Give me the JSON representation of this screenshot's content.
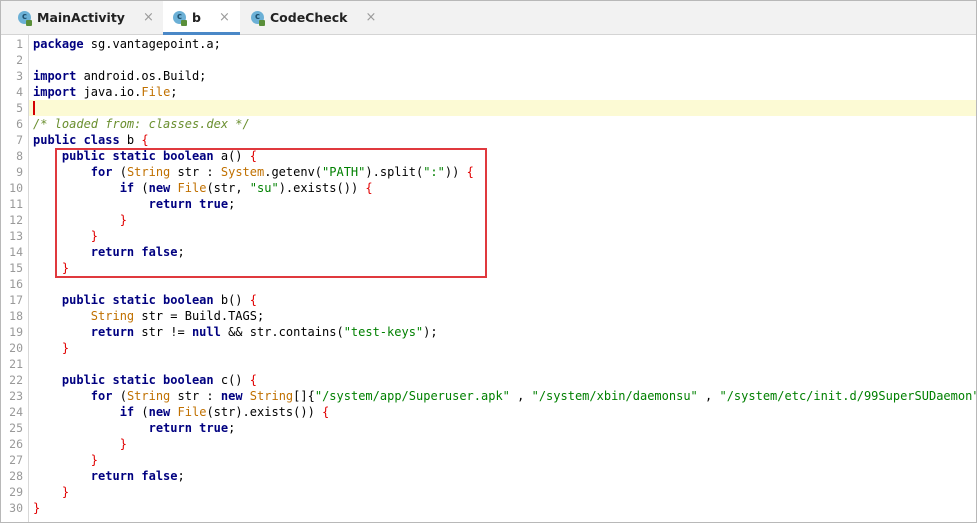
{
  "tabs": [
    {
      "label": "MainActivity",
      "icon": "class-icon",
      "active": false
    },
    {
      "label": "b",
      "icon": "class-icon",
      "active": true
    },
    {
      "label": "CodeCheck",
      "icon": "class-icon",
      "active": false
    }
  ],
  "tab_close_glyph": "×",
  "class_icon_letter": "c",
  "editor": {
    "current_line": 5,
    "highlight_color": "#fcfad4",
    "lines": [
      [
        {
          "t": "package",
          "c": "kw"
        },
        {
          "t": " sg.vantagepoint.a;",
          "c": ""
        }
      ],
      [],
      [
        {
          "t": "import",
          "c": "kw"
        },
        {
          "t": " android.os.Build;",
          "c": ""
        }
      ],
      [
        {
          "t": "import",
          "c": "kw"
        },
        {
          "t": " java.io.",
          "c": ""
        },
        {
          "t": "File",
          "c": "cls"
        },
        {
          "t": ";",
          "c": ""
        }
      ],
      [],
      [
        {
          "t": "/* loaded from: classes.dex */",
          "c": "cmt"
        }
      ],
      [
        {
          "t": "public class",
          "c": "kw"
        },
        {
          "t": " b ",
          "c": ""
        },
        {
          "t": "{",
          "c": "brace"
        }
      ],
      [
        {
          "t": "    ",
          "c": ""
        },
        {
          "t": "public static boolean",
          "c": "kw"
        },
        {
          "t": " a() ",
          "c": ""
        },
        {
          "t": "{",
          "c": "brace"
        }
      ],
      [
        {
          "t": "        ",
          "c": ""
        },
        {
          "t": "for",
          "c": "kw"
        },
        {
          "t": " (",
          "c": ""
        },
        {
          "t": "String",
          "c": "cls"
        },
        {
          "t": " str : ",
          "c": ""
        },
        {
          "t": "System",
          "c": "cls"
        },
        {
          "t": ".getenv(",
          "c": ""
        },
        {
          "t": "\"PATH\"",
          "c": "str"
        },
        {
          "t": ").split(",
          "c": ""
        },
        {
          "t": "\":\"",
          "c": "str"
        },
        {
          "t": ")) ",
          "c": ""
        },
        {
          "t": "{",
          "c": "brace"
        }
      ],
      [
        {
          "t": "            ",
          "c": ""
        },
        {
          "t": "if",
          "c": "kw"
        },
        {
          "t": " (",
          "c": ""
        },
        {
          "t": "new",
          "c": "kw"
        },
        {
          "t": " ",
          "c": ""
        },
        {
          "t": "File",
          "c": "cls"
        },
        {
          "t": "(str, ",
          "c": ""
        },
        {
          "t": "\"su\"",
          "c": "str"
        },
        {
          "t": ").exists()) ",
          "c": ""
        },
        {
          "t": "{",
          "c": "brace"
        }
      ],
      [
        {
          "t": "                ",
          "c": ""
        },
        {
          "t": "return true",
          "c": "kw"
        },
        {
          "t": ";",
          "c": ""
        }
      ],
      [
        {
          "t": "            ",
          "c": ""
        },
        {
          "t": "}",
          "c": "brace"
        }
      ],
      [
        {
          "t": "        ",
          "c": ""
        },
        {
          "t": "}",
          "c": "brace"
        }
      ],
      [
        {
          "t": "        ",
          "c": ""
        },
        {
          "t": "return false",
          "c": "kw"
        },
        {
          "t": ";",
          "c": ""
        }
      ],
      [
        {
          "t": "    ",
          "c": ""
        },
        {
          "t": "}",
          "c": "brace"
        }
      ],
      [],
      [
        {
          "t": "    ",
          "c": ""
        },
        {
          "t": "public static boolean",
          "c": "kw"
        },
        {
          "t": " b() ",
          "c": ""
        },
        {
          "t": "{",
          "c": "brace"
        }
      ],
      [
        {
          "t": "        ",
          "c": ""
        },
        {
          "t": "String",
          "c": "cls"
        },
        {
          "t": " str = Build.",
          "c": ""
        },
        {
          "t": "TAGS",
          "c": ""
        },
        {
          "t": ";",
          "c": ""
        }
      ],
      [
        {
          "t": "        ",
          "c": ""
        },
        {
          "t": "return",
          "c": "kw"
        },
        {
          "t": " str != ",
          "c": ""
        },
        {
          "t": "null",
          "c": "kw"
        },
        {
          "t": " && str.contains(",
          "c": ""
        },
        {
          "t": "\"test-keys\"",
          "c": "str"
        },
        {
          "t": ");",
          "c": ""
        }
      ],
      [
        {
          "t": "    ",
          "c": ""
        },
        {
          "t": "}",
          "c": "brace"
        }
      ],
      [],
      [
        {
          "t": "    ",
          "c": ""
        },
        {
          "t": "public static boolean",
          "c": "kw"
        },
        {
          "t": " c() ",
          "c": ""
        },
        {
          "t": "{",
          "c": "brace"
        }
      ],
      [
        {
          "t": "        ",
          "c": ""
        },
        {
          "t": "for",
          "c": "kw"
        },
        {
          "t": " (",
          "c": ""
        },
        {
          "t": "String",
          "c": "cls"
        },
        {
          "t": " str : ",
          "c": ""
        },
        {
          "t": "new",
          "c": "kw"
        },
        {
          "t": " ",
          "c": ""
        },
        {
          "t": "String",
          "c": "cls"
        },
        {
          "t": "[]{",
          "c": ""
        },
        {
          "t": "\"/system/app/Superuser.apk\"",
          "c": "str"
        },
        {
          "t": " , ",
          "c": ""
        },
        {
          "t": "\"/system/xbin/daemonsu\"",
          "c": "str"
        },
        {
          "t": " , ",
          "c": ""
        },
        {
          "t": "\"/system/etc/init.d/99SuperSUDaemon\"",
          "c": "str"
        },
        {
          "t": " ,",
          "c": ""
        }
      ],
      [
        {
          "t": "            ",
          "c": ""
        },
        {
          "t": "if",
          "c": "kw"
        },
        {
          "t": " (",
          "c": ""
        },
        {
          "t": "new",
          "c": "kw"
        },
        {
          "t": " ",
          "c": ""
        },
        {
          "t": "File",
          "c": "cls"
        },
        {
          "t": "(str).exists()) ",
          "c": ""
        },
        {
          "t": "{",
          "c": "brace"
        }
      ],
      [
        {
          "t": "                ",
          "c": ""
        },
        {
          "t": "return true",
          "c": "kw"
        },
        {
          "t": ";",
          "c": ""
        }
      ],
      [
        {
          "t": "            ",
          "c": ""
        },
        {
          "t": "}",
          "c": "brace"
        }
      ],
      [
        {
          "t": "        ",
          "c": ""
        },
        {
          "t": "}",
          "c": "brace"
        }
      ],
      [
        {
          "t": "        ",
          "c": ""
        },
        {
          "t": "return false",
          "c": "kw"
        },
        {
          "t": ";",
          "c": ""
        }
      ],
      [
        {
          "t": "    ",
          "c": ""
        },
        {
          "t": "}",
          "c": "brace"
        }
      ],
      [
        {
          "t": "}",
          "c": "brace"
        }
      ]
    ]
  },
  "annotation_color": "#e0393e"
}
